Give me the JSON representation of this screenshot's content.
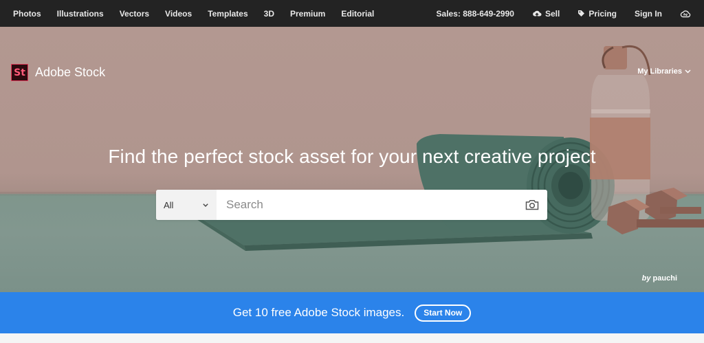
{
  "topnav": {
    "items": [
      "Photos",
      "Illustrations",
      "Vectors",
      "Videos",
      "Templates",
      "3D",
      "Premium",
      "Editorial"
    ],
    "sales": "Sales: 888-649-2990",
    "sell": "Sell",
    "pricing": "Pricing",
    "signin": "Sign In",
    "icons": [
      "sell-cloud-upload-icon",
      "pricing-tag-icon",
      "creative-cloud-icon"
    ]
  },
  "hero": {
    "logo_mark": "St",
    "logo_text": "Adobe Stock",
    "my_libraries": "My Libraries",
    "headline": "Find the perfect stock asset for your next creative project",
    "search": {
      "scope": "All",
      "placeholder": "Search"
    },
    "credit_prefix": "by",
    "credit_name": "pauchi"
  },
  "promo": {
    "text": "Get 10 free Adobe Stock images.",
    "button": "Start Now"
  },
  "colors": {
    "topnav_bg": "#232323",
    "promo_bg": "#2b83ea",
    "logo_accent": "#ff5a79"
  }
}
